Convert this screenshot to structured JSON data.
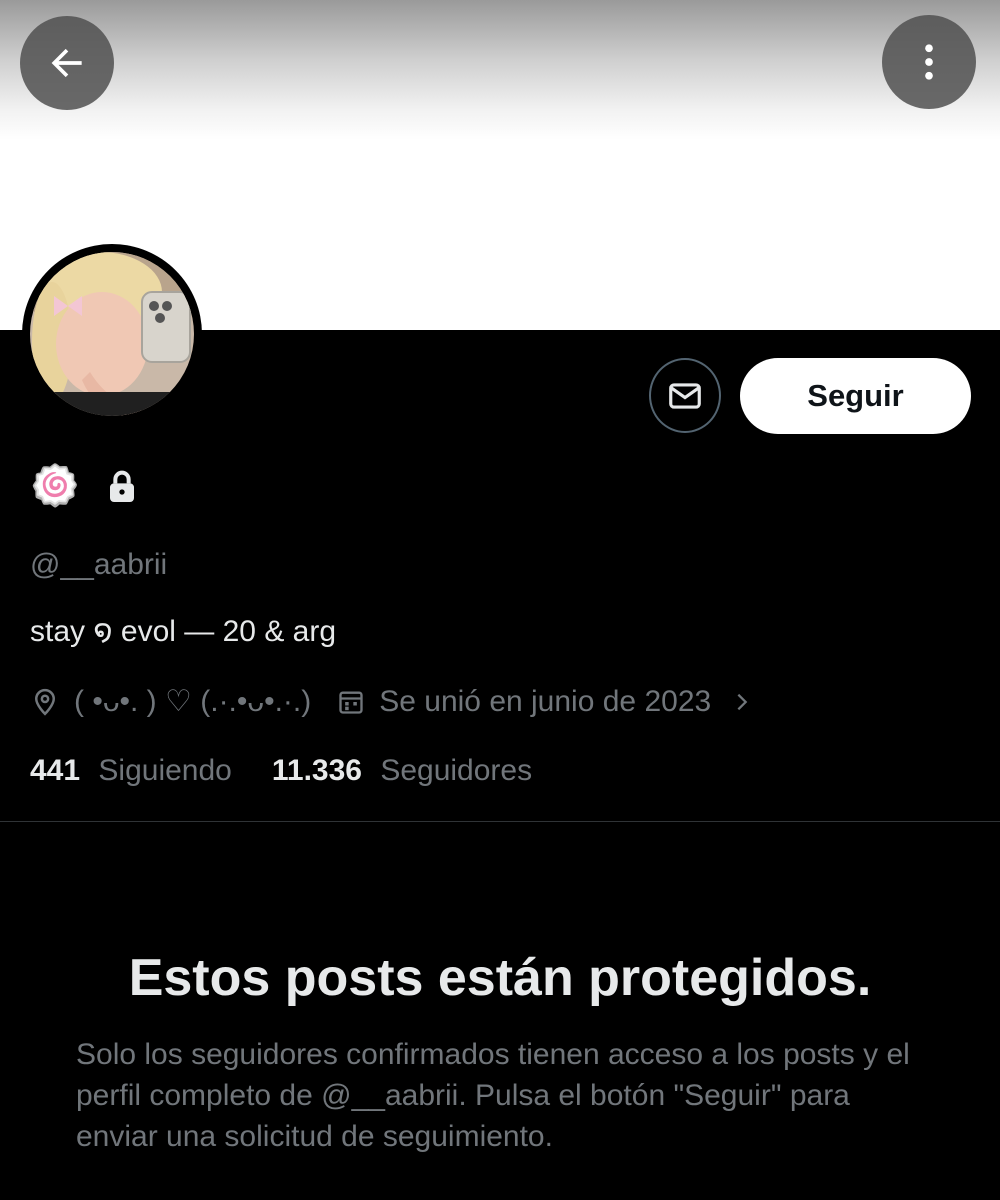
{
  "header": {
    "back_icon": "arrow-left-icon",
    "more_icon": "more-vertical-icon"
  },
  "profile": {
    "display_name_emoji": "🍥",
    "protected_icon": "lock-icon",
    "handle": "@__aabrii",
    "bio": "stay ໑ evol — 20 & arg",
    "location": "( •ᴗ•. )  ♡  (.·.•ᴗ•.·.)",
    "joined": "Se unió en junio de 2023",
    "following_count": "441",
    "following_label": "Siguiendo",
    "followers_count": "11.336",
    "followers_label": "Seguidores"
  },
  "actions": {
    "message_icon": "envelope-icon",
    "follow_label": "Seguir"
  },
  "protected_notice": {
    "title": "Estos posts están protegidos.",
    "text": "Solo los seguidores confirmados tienen acceso a los posts y el perfil completo de @__aabrii. Pulsa el botón \"Seguir\" para enviar una solicitud de seguimiento."
  },
  "colors": {
    "background": "#000000",
    "text_primary": "#e7e9ea",
    "text_secondary": "#71767b",
    "follow_button_bg": "#ffffff",
    "divider": "#2f3336"
  }
}
